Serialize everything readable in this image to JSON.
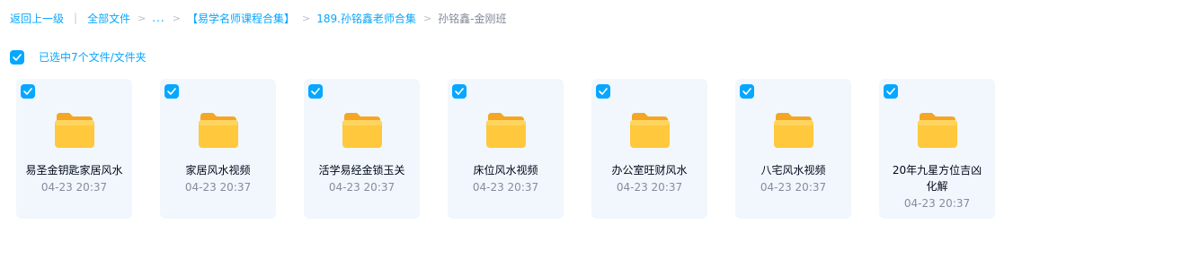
{
  "breadcrumb": {
    "back": "返回上一级",
    "all_files": "全部文件",
    "ellipsis": "...",
    "items": [
      "【易学名师课程合集】",
      "189.孙铭鑫老师合集"
    ],
    "current": "孙铭鑫-金刚班"
  },
  "selection": {
    "label": "已选中7个文件/文件夹"
  },
  "folders": [
    {
      "name": "易圣金钥匙家居风水",
      "time": "04-23 20:37"
    },
    {
      "name": "家居风水视频",
      "time": "04-23 20:37"
    },
    {
      "name": "活学易经金锁玉关",
      "time": "04-23 20:37"
    },
    {
      "name": "床位风水视频",
      "time": "04-23 20:37"
    },
    {
      "name": "办公室旺财风水",
      "time": "04-23 20:37"
    },
    {
      "name": "八宅风水视频",
      "time": "04-23 20:37"
    },
    {
      "name": "20年九星方位吉凶化解",
      "time": "04-23 20:37"
    }
  ],
  "colors": {
    "accent": "#06a7ff",
    "card_bg": "#f1f7fc",
    "folder_yellow": "#ffc83d"
  },
  "icons": {
    "checkbox": "check-icon",
    "folder": "folder-icon",
    "chevron": "chevron-right-icon"
  }
}
